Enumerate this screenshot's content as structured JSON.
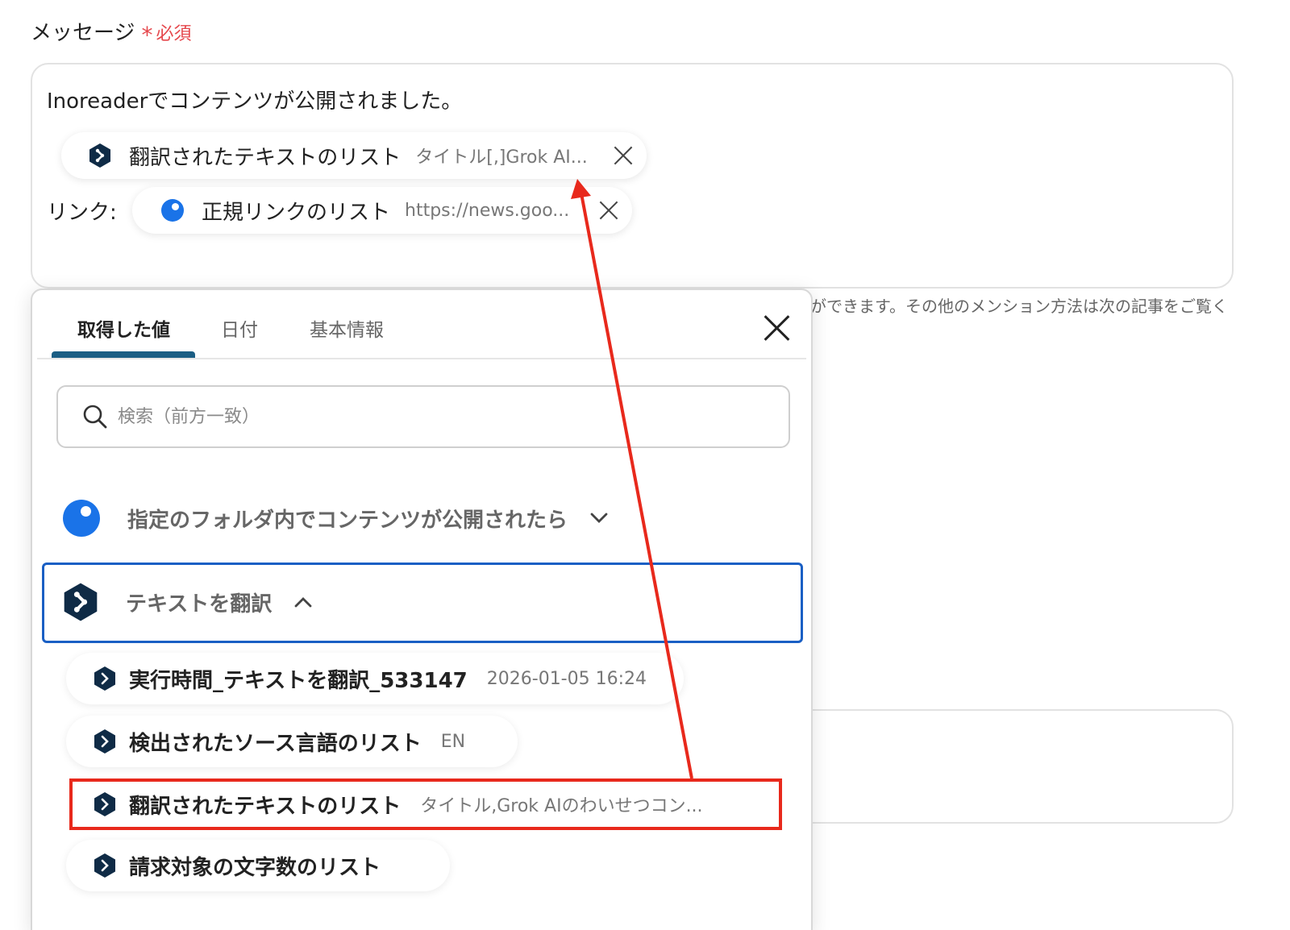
{
  "field": {
    "label": "メッセージ",
    "required_mark": "*",
    "required_text": "必須"
  },
  "message": {
    "line1": "Inoreaderでコンテンツが公開されました。",
    "link_label": "リンク:",
    "chips": [
      {
        "name": "翻訳されたテキストのリスト",
        "value": "タイトル[,]Grok AI...",
        "icon": "deepl-hex-icon"
      },
      {
        "name": "正規リンクのリスト",
        "value": "https://news.goo...",
        "icon": "inoreader-dot-icon"
      }
    ]
  },
  "hint": "ができます。その他のメンション方法は次の記事をご覧く",
  "panel": {
    "tabs": [
      {
        "label": "取得した値",
        "active": true
      },
      {
        "label": "日付",
        "active": false
      },
      {
        "label": "基本情報",
        "active": false
      }
    ],
    "search_placeholder": "検索（前方一致）",
    "groups": [
      {
        "title": "指定のフォルダ内でコンテンツが公開されたら",
        "icon": "inoreader-dot-icon",
        "expanded": false
      },
      {
        "title": "テキストを翻訳",
        "icon": "deepl-hex-icon",
        "expanded": true
      }
    ],
    "items": [
      {
        "name": "実行時間_テキストを翻訳_533147",
        "value": "2026-01-05 16:24"
      },
      {
        "name": "検出されたソース言語のリスト",
        "value": "EN"
      },
      {
        "name": "翻訳されたテキストのリスト",
        "value": "タイトル,Grok AIのわいせつコン..."
      },
      {
        "name": "請求対象の文字数のリスト",
        "value": ""
      }
    ]
  },
  "colors": {
    "accent": "#1b5e84",
    "required": "#e5484d",
    "highlight": "#e8291c",
    "inoreader_blue": "#1a73e8",
    "deepl_navy": "#0f2b46"
  }
}
